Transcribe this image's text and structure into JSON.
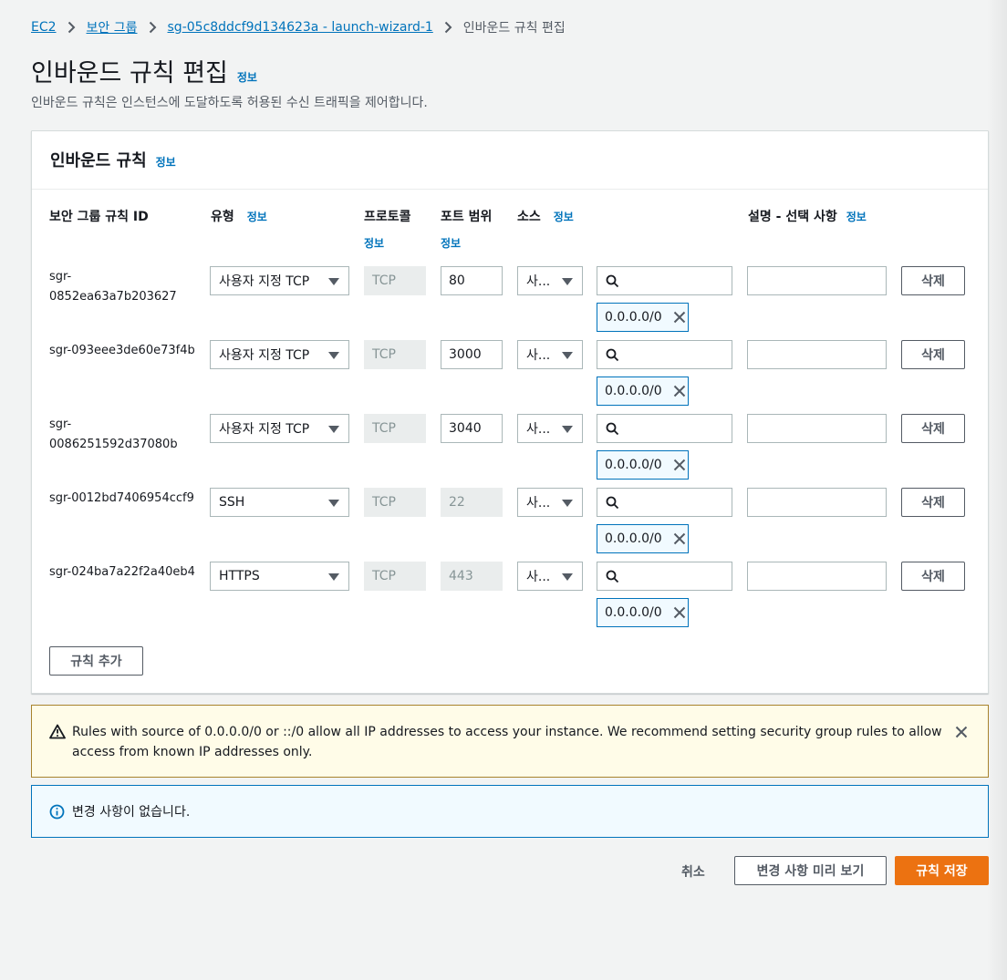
{
  "breadcrumb": {
    "items": [
      "EC2",
      "보안 그룹",
      "sg-05c8ddcf9d134623a - launch-wizard-1"
    ],
    "current": "인바운드 규칙 편집"
  },
  "page": {
    "title": "인바운드 규칙 편집",
    "info": "정보",
    "description": "인바운드 규칙은 인스턴스에 도달하도록 허용된 수신 트래픽을 제어합니다."
  },
  "panel": {
    "title": "인바운드 규칙",
    "info": "정보",
    "columns": {
      "rule_id": "보안 그룹 규칙 ID",
      "type": "유형",
      "protocol": "프로토콜",
      "port_range": "포트 범위",
      "source": "소스",
      "description": "설명 - 선택 사항",
      "info": "정보"
    },
    "rows": [
      {
        "id": "sgr-0852ea63a7b203627",
        "type": "사용자 지정 TCP",
        "protocol": "TCP",
        "port": "80",
        "source": "사...",
        "cidr": "0.0.0.0/0",
        "delete": "삭제"
      },
      {
        "id": "sgr-093eee3de60e73f4b",
        "type": "사용자 지정 TCP",
        "protocol": "TCP",
        "port": "3000",
        "source": "사...",
        "cidr": "0.0.0.0/0",
        "delete": "삭제"
      },
      {
        "id": "sgr-0086251592d37080b",
        "type": "사용자 지정 TCP",
        "protocol": "TCP",
        "port": "3040",
        "source": "사...",
        "cidr": "0.0.0.0/0",
        "delete": "삭제"
      },
      {
        "id": "sgr-0012bd7406954ccf9",
        "type": "SSH",
        "protocol": "TCP",
        "port": "22",
        "source": "사...",
        "cidr": "0.0.0.0/0",
        "delete": "삭제"
      },
      {
        "id": "sgr-024ba7a22f2a40eb4",
        "type": "HTTPS",
        "protocol": "TCP",
        "port": "443",
        "source": "사...",
        "cidr": "0.0.0.0/0",
        "delete": "삭제"
      }
    ],
    "add_rule": "규칙 추가"
  },
  "warning": {
    "text": "Rules with source of 0.0.0.0/0 or ::/0 allow all IP addresses to access your instance. We recommend setting security group rules to allow access from known IP addresses only."
  },
  "notice": {
    "text": "변경 사항이 없습니다."
  },
  "footer": {
    "cancel": "취소",
    "preview": "변경 사항 미리 보기",
    "save": "규칙 저장"
  },
  "colors": {
    "link": "#0073bb",
    "primary": "#ec7211",
    "warning_border": "#a8832d",
    "warning_bg": "#fffce8",
    "info_bg": "#f1faff"
  }
}
